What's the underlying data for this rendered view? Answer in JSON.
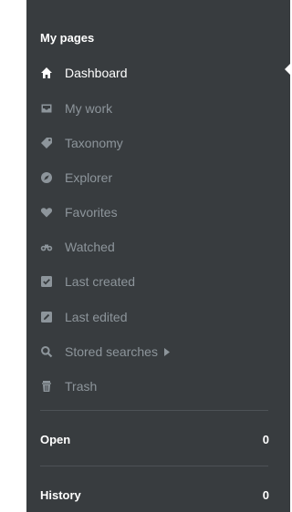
{
  "sidebar": {
    "section_title": "My pages",
    "items": [
      {
        "label": "Dashboard",
        "icon": "home-icon",
        "active": true
      },
      {
        "label": "My work",
        "icon": "inbox-icon"
      },
      {
        "label": "Taxonomy",
        "icon": "tag-icon"
      },
      {
        "label": "Explorer",
        "icon": "compass-icon"
      },
      {
        "label": "Favorites",
        "icon": "heart-icon"
      },
      {
        "label": "Watched",
        "icon": "binoculars-icon"
      },
      {
        "label": "Last created",
        "icon": "checkbox-icon"
      },
      {
        "label": "Last edited",
        "icon": "edit-icon"
      },
      {
        "label": "Stored searches",
        "icon": "search-icon",
        "has_submenu": true
      },
      {
        "label": "Trash",
        "icon": "trash-icon"
      }
    ],
    "groups": [
      {
        "label": "Open",
        "count": "0"
      },
      {
        "label": "History",
        "count": "0"
      }
    ],
    "colors": {
      "background": "#383c3f",
      "text_active": "#ffffff",
      "text_muted": "#8d959b",
      "divider": "#4d5256"
    }
  }
}
